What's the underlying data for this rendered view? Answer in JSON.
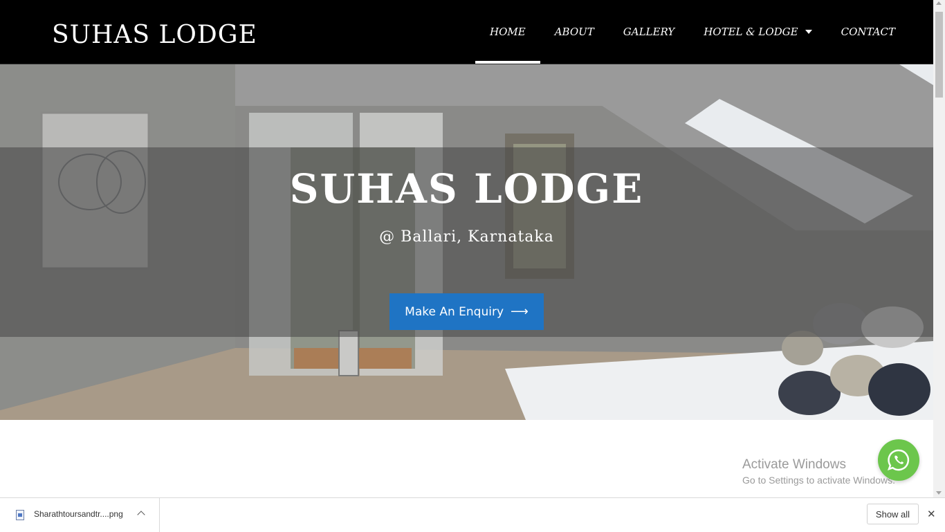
{
  "header": {
    "logo": "SUHAS LODGE",
    "nav": [
      {
        "label": "HOME",
        "active": true
      },
      {
        "label": "ABOUT"
      },
      {
        "label": "GALLERY"
      },
      {
        "label": "HOTEL & LODGE",
        "has_dropdown": true
      },
      {
        "label": "CONTACT"
      }
    ]
  },
  "hero": {
    "title": "SUHAS LODGE",
    "subtitle": "@ Ballari, Karnataka",
    "cta_label": "Make An Enquiry",
    "cta_icon": "arrow-right-icon"
  },
  "watermark": {
    "title": "Activate Windows",
    "subtitle": "Go to Settings to activate Windows."
  },
  "whatsapp": {
    "icon": "whatsapp-icon"
  },
  "download_bar": {
    "file_name": "Sharathtoursandtr....png",
    "show_all_label": "Show all"
  },
  "colors": {
    "header_bg": "#000000",
    "cta_bg": "#1f74c4",
    "whatsapp_bg": "#6cc64c"
  }
}
